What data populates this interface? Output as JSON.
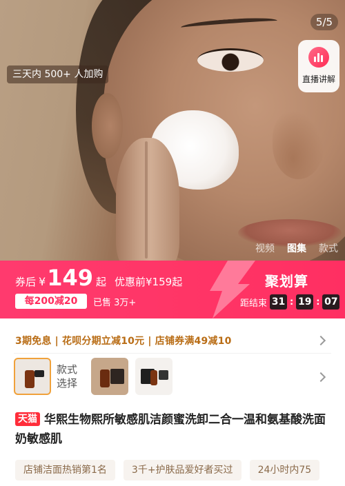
{
  "hero": {
    "counter": "5/5",
    "live_label": "直播讲解",
    "buyers_badge": "三天内 500+ 人加购",
    "media_tabs": [
      "视频",
      "图集",
      "款式"
    ],
    "media_active": "图集"
  },
  "promo": {
    "price_prefix": "券后",
    "currency": "¥",
    "price": "149",
    "price_suffix": "起",
    "original": "优惠前¥159起",
    "coupon": "每200减20",
    "sold": "已售 3万+",
    "campaign": "聚划算",
    "countdown_label": "距结束",
    "countdown": [
      "31",
      "19",
      "07"
    ],
    "colors": {
      "band": "#ff3566",
      "coupon_text": "#ff2d5e"
    }
  },
  "perks": {
    "text": "3期免息 | 花呗分期立减10元 | 店铺券满49减10"
  },
  "variants": {
    "label_line1": "款式",
    "label_line2": "选择"
  },
  "product": {
    "badge": "天猫",
    "title": "华熙生物熙所敏感肌洁颜蜜洗卸二合一温和氨基酸洗面奶敏感肌"
  },
  "tags": [
    "店铺洁面热销第1名",
    "3千+护肤品爱好者买过",
    "24小时内75"
  ]
}
